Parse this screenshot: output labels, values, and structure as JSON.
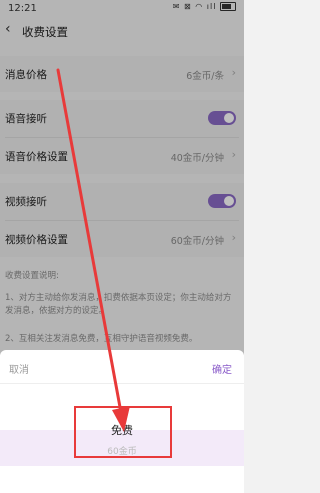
{
  "status_bar": {
    "time": "12:21",
    "icons": "✉ ⊠ ◠ ıll"
  },
  "nav": {
    "back_icon": "chevron-left-icon",
    "title": "收费设置"
  },
  "rows": {
    "message_price": {
      "label": "消息价格",
      "value": "6金币/条"
    },
    "voice_answer": {
      "label": "语音接听",
      "toggle": "on"
    },
    "voice_price": {
      "label": "语音价格设置",
      "value": "40金币/分钟"
    },
    "video_answer": {
      "label": "视频接听",
      "toggle": "on"
    },
    "video_price": {
      "label": "视频价格设置",
      "value": "60金币/分钟"
    }
  },
  "notes": {
    "heading": "收费设置说明:",
    "line1": "1、对方主动给你发消息，扣费依据本页设定；你主动给对方发消息，依据对方的设定。",
    "line2": "2、互相关注发消息免费，互相守护语音视频免费。"
  },
  "sheet": {
    "cancel": "取消",
    "confirm": "确定",
    "option_selected": "免费",
    "option_next": "60金币"
  },
  "colors": {
    "accent": "#8a6ac4",
    "annotation": "#e83a3a"
  }
}
